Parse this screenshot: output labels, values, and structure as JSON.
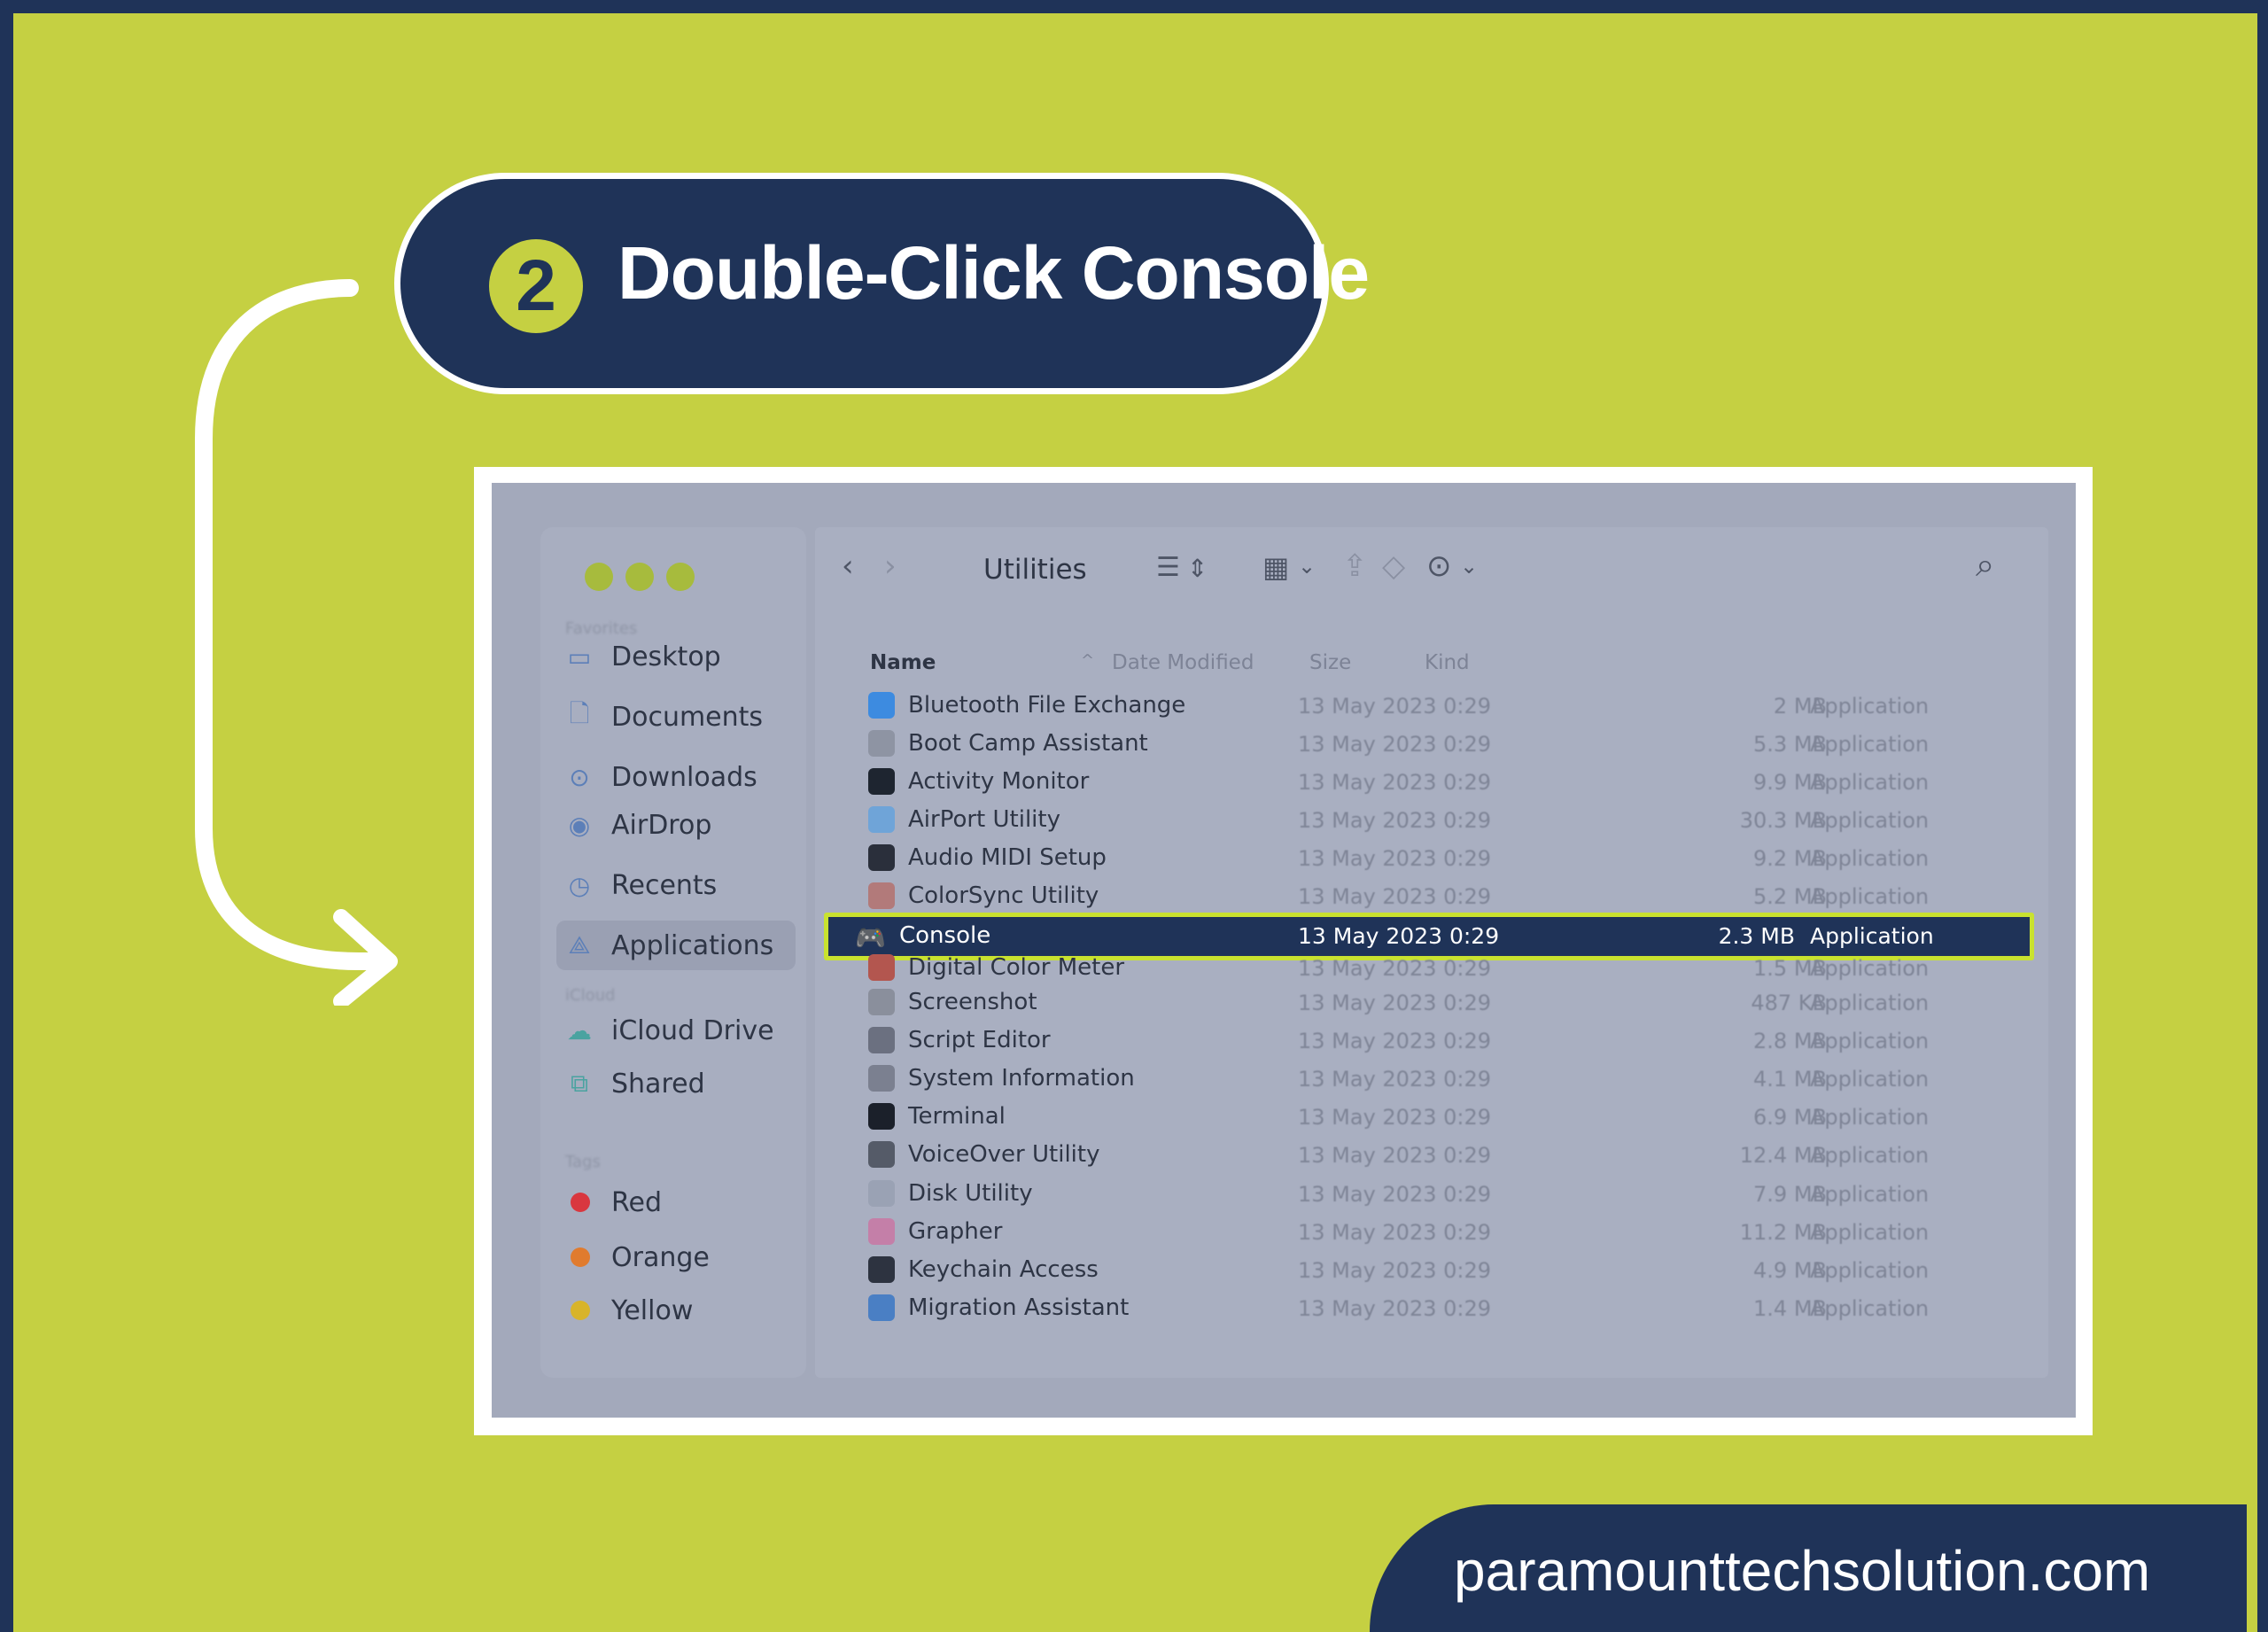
{
  "banner": {
    "step_number": "2",
    "title": "Double-Click Console"
  },
  "window": {
    "traffic_lights": [
      "close",
      "minimize",
      "zoom"
    ],
    "sidebar": {
      "sections": [
        {
          "title": "Favorites",
          "items": [
            {
              "label": "Desktop",
              "icon": "desktop-icon"
            },
            {
              "label": "Documents",
              "icon": "document-icon"
            },
            {
              "label": "Downloads",
              "icon": "download-icon"
            },
            {
              "label": "AirDrop",
              "icon": "airdrop-icon"
            },
            {
              "label": "Recents",
              "icon": "clock-icon"
            },
            {
              "label": "Applications",
              "icon": "applications-icon",
              "active": true
            }
          ]
        },
        {
          "title": "iCloud",
          "items": [
            {
              "label": "iCloud Drive",
              "icon": "cloud-icon"
            },
            {
              "label": "Shared",
              "icon": "shared-folder-icon"
            }
          ]
        },
        {
          "title": "Tags",
          "items": [
            {
              "label": "Red",
              "color": "#d9373f"
            },
            {
              "label": "Orange",
              "color": "#e07b2e"
            },
            {
              "label": "Yellow",
              "color": "#d8b42a"
            }
          ]
        }
      ]
    },
    "toolbar": {
      "title": "Utilities",
      "back": "‹",
      "forward": "›",
      "view_list": "☰",
      "sort_toggle": "⇕",
      "group": "▦",
      "chevron": "⌄",
      "share": "⇪",
      "tag": "◇",
      "more": "⊙",
      "search": "⌕"
    },
    "columns": {
      "name": "Name",
      "sort_indicator": "^",
      "date": "Date Modified",
      "size": "Size",
      "kind": "Kind"
    },
    "files": [
      {
        "name": "Bluetooth File Exchange",
        "date": "13 May 2023 0:29",
        "size": "2 MB",
        "kind": "Application",
        "color": "#3d8be0"
      },
      {
        "name": "Boot Camp Assistant",
        "date": "13 May 2023 0:29",
        "size": "5.3 MB",
        "kind": "Application",
        "color": "#8e94a3"
      },
      {
        "name": "Activity Monitor",
        "date": "13 May 2023 0:29",
        "size": "9.9 MB",
        "kind": "Application",
        "color": "#1e2530"
      },
      {
        "name": "AirPort Utility",
        "date": "13 May 2023 0:29",
        "size": "30.3 MB",
        "kind": "Application",
        "color": "#6fa4d8"
      },
      {
        "name": "Audio MIDI Setup",
        "date": "13 May 2023 0:29",
        "size": "9.2 MB",
        "kind": "Application",
        "color": "#2a2f3b"
      },
      {
        "name": "ColorSync Utility",
        "date": "13 May 2023 0:29",
        "size": "5.2 MB",
        "kind": "Application",
        "color": "#b27a7a"
      },
      {
        "name": "Console",
        "date": "13 May 2023 0:29",
        "size": "2.3  MB",
        "kind": "Application",
        "selected": true
      },
      {
        "name": "Digital Color Meter",
        "date": "13 May 2023 0:29",
        "size": "1.5 MB",
        "kind": "Application",
        "color": "#b3564f"
      },
      {
        "name": "Screenshot",
        "date": "13 May 2023 0:29",
        "size": "487 KB",
        "kind": "Application",
        "color": "#8a8f9c"
      },
      {
        "name": "Script Editor",
        "date": "13 May 2023 0:29",
        "size": "2.8 MB",
        "kind": "Application",
        "color": "#6b7080"
      },
      {
        "name": "System Information",
        "date": "13 May 2023 0:29",
        "size": "4.1 MB",
        "kind": "Application",
        "color": "#7b8090"
      },
      {
        "name": "Terminal",
        "date": "13 May 2023 0:29",
        "size": "6.9 MB",
        "kind": "Application",
        "color": "#1b202a"
      },
      {
        "name": "VoiceOver Utility",
        "date": "13 May 2023 0:29",
        "size": "12.4 MB",
        "kind": "Application",
        "color": "#555b68"
      },
      {
        "name": "Disk Utility",
        "date": "13 May 2023 0:29",
        "size": "7.9 MB",
        "kind": "Application",
        "color": "#9aa2b4"
      },
      {
        "name": "Grapher",
        "date": "13 May 2023 0:29",
        "size": "11.2 MB",
        "kind": "Application",
        "color": "#c47fa8"
      },
      {
        "name": "Keychain Access",
        "date": "13 May 2023 0:29",
        "size": "4.9 MB",
        "kind": "Application",
        "color": "#2d3340"
      },
      {
        "name": "Migration Assistant",
        "date": "13 May 2023 0:29",
        "size": "1.4 MB",
        "kind": "Application",
        "color": "#4a7fc4"
      }
    ]
  },
  "footer": {
    "website": "paramounttechsolution.com"
  },
  "colors": {
    "navy": "#1f3358",
    "lime": "#c5d042",
    "highlight_border": "#c9e22f"
  }
}
